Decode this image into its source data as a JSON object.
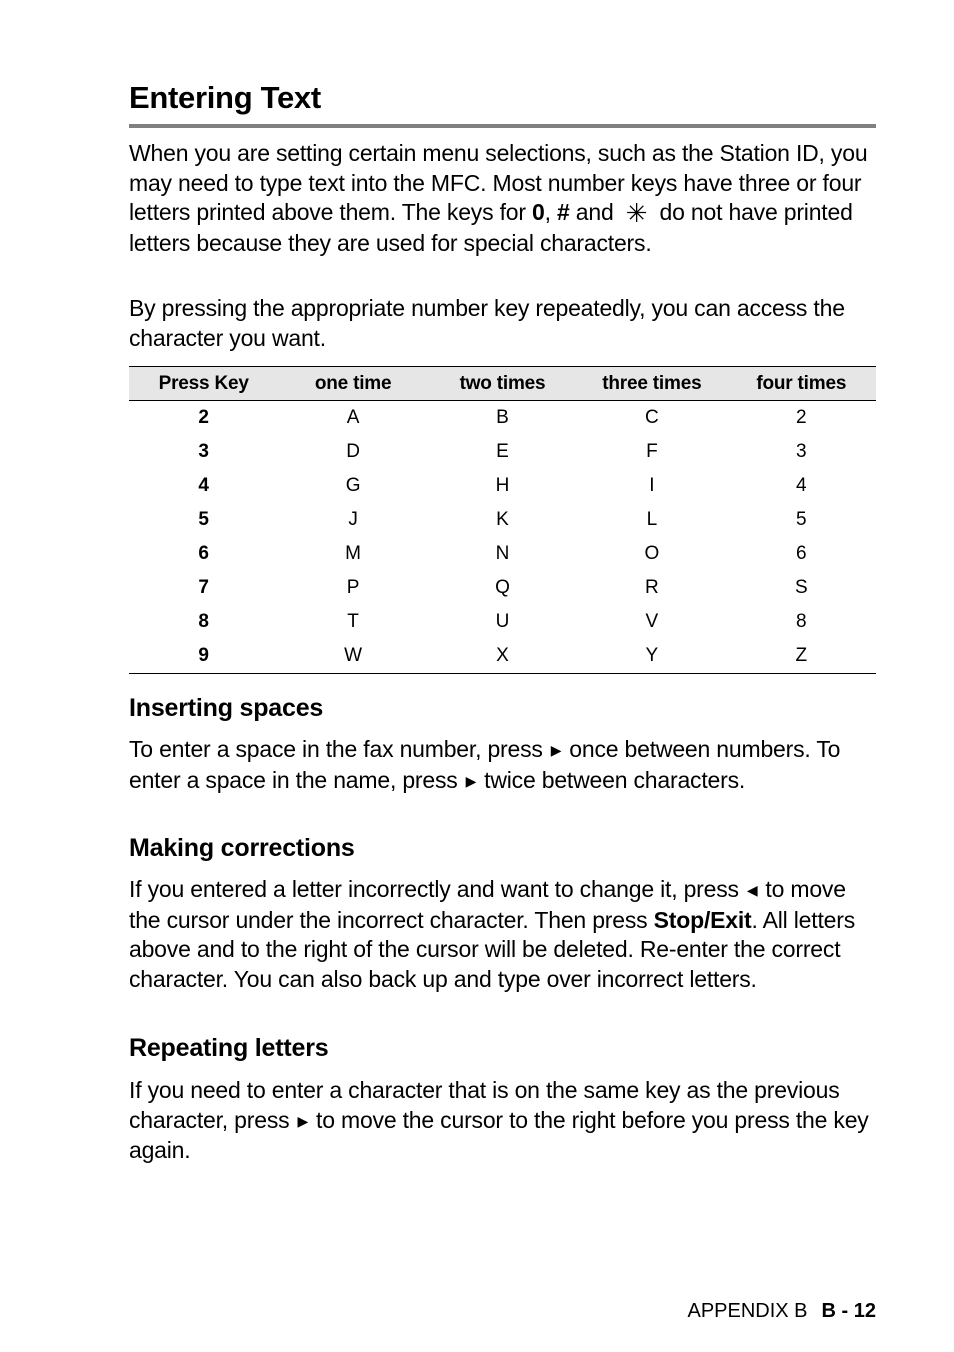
{
  "title": "Entering Text",
  "intro": {
    "p1_a": "When you are setting certain menu selections, such as the Station ID, you may need to type text into the MFC. Most number keys have three or four letters printed above them. The keys for ",
    "key_zero": "0",
    "sep": ", ",
    "key_hash": "#",
    "and": " and ",
    "star_icon": "✳",
    "p1_b": " do not have printed letters because they are used for special characters.",
    "p2": "By pressing the appropriate number key repeatedly, you can access the character you want."
  },
  "table": {
    "headers": [
      "Press Key",
      "one time",
      "two times",
      "three times",
      "four times"
    ],
    "rows": [
      [
        "2",
        "A",
        "B",
        "C",
        "2"
      ],
      [
        "3",
        "D",
        "E",
        "F",
        "3"
      ],
      [
        "4",
        "G",
        "H",
        "I",
        "4"
      ],
      [
        "5",
        "J",
        "K",
        "L",
        "5"
      ],
      [
        "6",
        "M",
        "N",
        "O",
        "6"
      ],
      [
        "7",
        "P",
        "Q",
        "R",
        "S"
      ],
      [
        "8",
        "T",
        "U",
        "V",
        "8"
      ],
      [
        "9",
        "W",
        "X",
        "Y",
        "Z"
      ]
    ]
  },
  "inserting": {
    "heading": "Inserting spaces",
    "t1": "To enter a space in the fax number, press",
    "t2": "once between numbers. To enter a space in the name, press",
    "t3": "twice between characters.",
    "arrow_right": "▶"
  },
  "corrections": {
    "heading": "Making corrections",
    "t1": "If you entered a letter incorrectly and want to change it, press",
    "arrow_left": "◀",
    "t2": "to move the cursor under the incorrect character. Then press ",
    "bold": "Stop/Exit",
    "t3": ". All letters above and to the right of the cursor will be deleted. Re-enter the correct character. You can also back up and type over incorrect letters."
  },
  "repeating": {
    "heading": "Repeating letters",
    "t1": "If you need to enter a character that is on the same key as the previous character, press",
    "arrow_right": "▶",
    "t2": "to move the cursor to the right before you press the key again."
  },
  "footer": {
    "section": "APPENDIX B",
    "page": "B - 12"
  }
}
